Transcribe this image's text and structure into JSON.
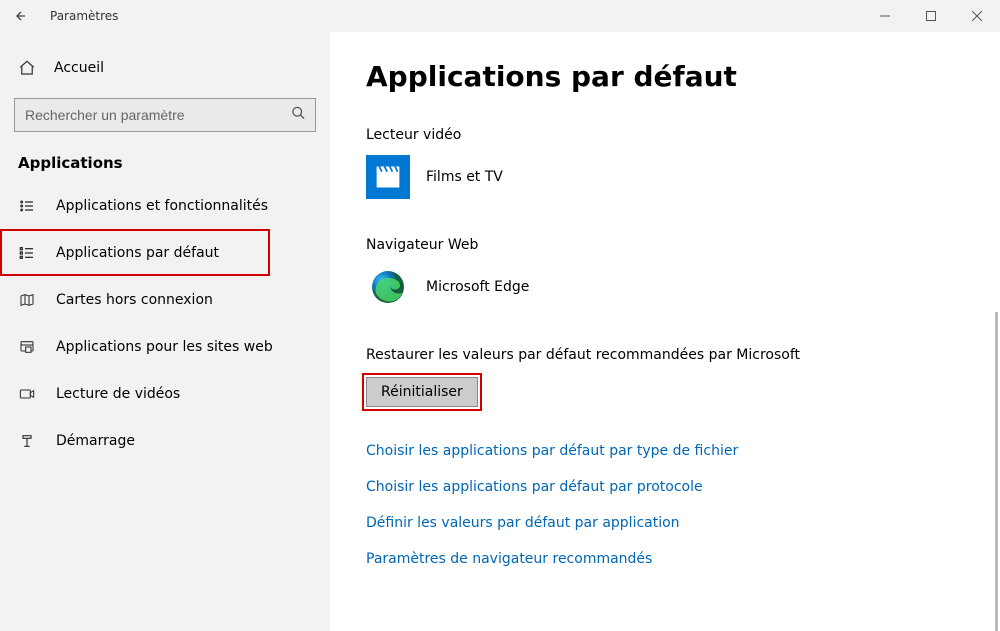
{
  "window": {
    "title": "Paramètres"
  },
  "sidebar": {
    "home_label": "Accueil",
    "search_placeholder": "Rechercher un paramètre",
    "section_label": "Applications",
    "items": [
      {
        "label": "Applications et fonctionnalités",
        "icon": "list-apps"
      },
      {
        "label": "Applications par défaut",
        "icon": "list-default",
        "highlighted": true
      },
      {
        "label": "Cartes hors connexion",
        "icon": "map-offline"
      },
      {
        "label": "Applications pour les sites web",
        "icon": "apps-web"
      },
      {
        "label": "Lecture de vidéos",
        "icon": "video-playback"
      },
      {
        "label": "Démarrage",
        "icon": "startup"
      }
    ]
  },
  "main": {
    "heading": "Applications par défaut",
    "groups": {
      "video": {
        "label": "Lecteur vidéo",
        "app_name": "Films et TV"
      },
      "browser": {
        "label": "Navigateur Web",
        "app_name": "Microsoft Edge"
      }
    },
    "reset": {
      "caption": "Restaurer les valeurs par défaut recommandées par Microsoft",
      "button": "Réinitialiser"
    },
    "links": [
      "Choisir les applications par défaut par type de fichier",
      "Choisir les applications par défaut par protocole",
      "Définir les valeurs par défaut par application",
      "Paramètres de navigateur recommandés"
    ]
  }
}
